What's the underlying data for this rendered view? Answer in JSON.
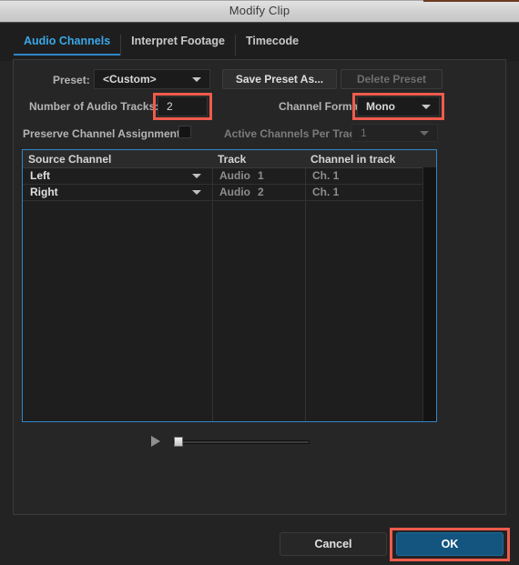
{
  "window": {
    "title": "Modify Clip"
  },
  "tabs": [
    {
      "label": "Audio Channels",
      "active": true
    },
    {
      "label": "Interpret Footage",
      "active": false
    },
    {
      "label": "Timecode",
      "active": false
    }
  ],
  "form": {
    "preset_label": "Preset:",
    "preset_value": "<Custom>",
    "save_preset_label": "Save Preset As...",
    "delete_preset_label": "Delete Preset",
    "tracks_label": "Number of Audio Tracks:",
    "tracks_value": "2",
    "channel_format_label": "Channel Format:",
    "channel_format_value": "Mono",
    "preserve_label": "Preserve Channel Assignments",
    "active_channels_label": "Active Channels Per Track:",
    "active_channels_value": "1"
  },
  "table": {
    "headers": [
      "Source Channel",
      "Track",
      "Channel in track"
    ],
    "rows": [
      {
        "source": "Left",
        "track": "Audio",
        "track_num": "1",
        "channel": "Ch. 1"
      },
      {
        "source": "Right",
        "track": "Audio",
        "track_num": "2",
        "channel": "Ch. 1"
      }
    ]
  },
  "footer": {
    "cancel_label": "Cancel",
    "ok_label": "OK"
  },
  "colors": {
    "accent_blue": "#3aa7e8",
    "ok_button": "#14557f",
    "highlight_red": "#ef5b4c",
    "table_focus_border": "#2f86c8"
  }
}
